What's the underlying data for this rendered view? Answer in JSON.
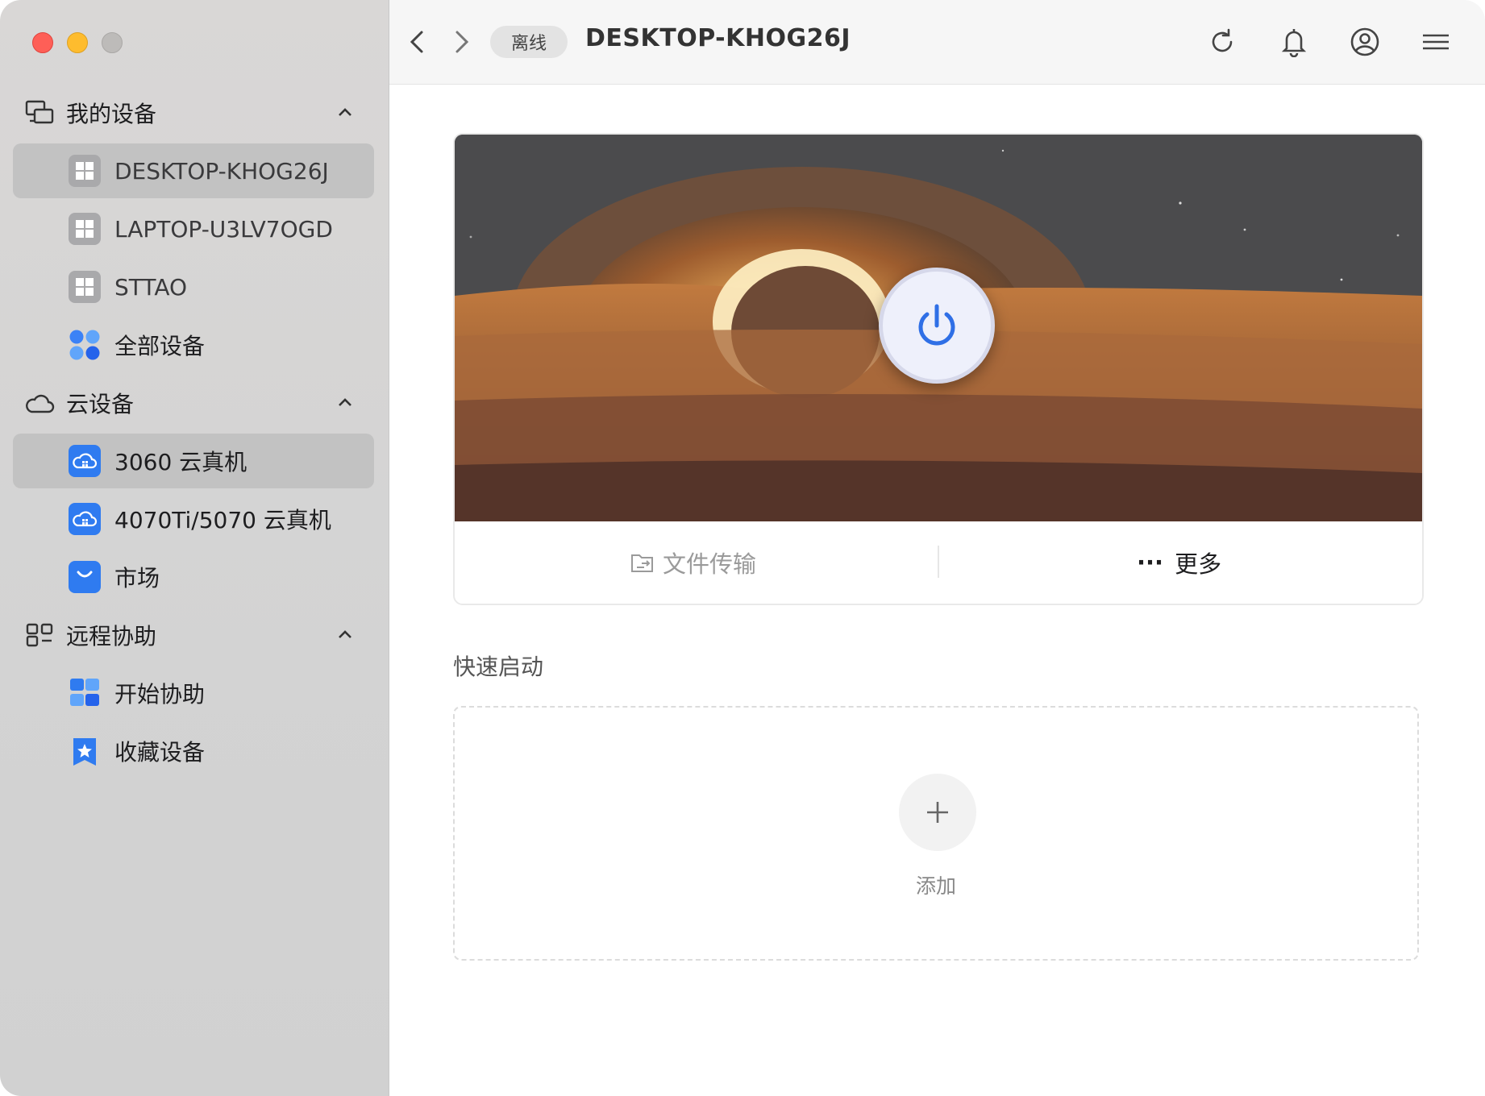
{
  "sidebar": {
    "sections": [
      {
        "label": "我的设备",
        "icon": "devices-icon"
      },
      {
        "label": "云设备",
        "icon": "cloud-icon"
      },
      {
        "label": "远程协助",
        "icon": "remote-assist-icon"
      }
    ],
    "my_devices": [
      {
        "label": "DESKTOP-KHOG26J",
        "icon": "windows-icon",
        "selected": true
      },
      {
        "label": "LAPTOP-U3LV7OGD",
        "icon": "windows-icon"
      },
      {
        "label": "STTAO",
        "icon": "windows-icon"
      },
      {
        "label": "全部设备",
        "icon": "all-devices-icon"
      }
    ],
    "cloud_devices": [
      {
        "label": "3060 云真机",
        "icon": "cloud-pc-icon",
        "selected": true
      },
      {
        "label": "4070Ti/5070 云真机",
        "icon": "cloud-pc-icon"
      },
      {
        "label": "市场",
        "icon": "market-bag-icon"
      }
    ],
    "remote_assist": [
      {
        "label": "开始协助",
        "icon": "start-assist-icon"
      },
      {
        "label": "收藏设备",
        "icon": "favorite-device-icon"
      }
    ]
  },
  "topbar": {
    "status_badge": "离线",
    "title": "DESKTOP-KHOG26J",
    "icons": [
      "back-arrow-icon",
      "forward-arrow-icon",
      "refresh-icon",
      "bell-icon",
      "user-icon",
      "menu-icon"
    ]
  },
  "device_card": {
    "file_transfer_label": "文件传输",
    "more_label": "更多",
    "more_prefix": "···"
  },
  "quick_launch": {
    "title": "快速启动",
    "add_label": "添加"
  },
  "colors": {
    "accent": "#2f6fe6",
    "traffic_red": "#fe5f57",
    "traffic_yellow": "#febc2e",
    "sidebar_bg": "#d7d6d5",
    "selected_bg": "#c2c2c2"
  }
}
